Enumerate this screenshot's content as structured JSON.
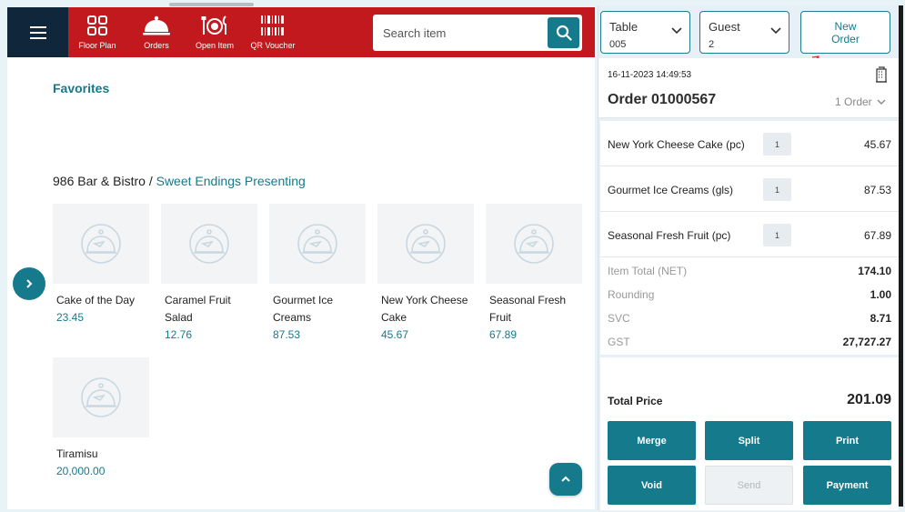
{
  "nav": {
    "items": [
      {
        "label": "Floor Plan",
        "icon": "grid-icon"
      },
      {
        "label": "Orders",
        "icon": "cloche-icon"
      },
      {
        "label": "Open Item",
        "icon": "cutlery-plate-icon"
      },
      {
        "label": "QR Voucher",
        "icon": "barcode-icon"
      }
    ],
    "search_placeholder": "Search item"
  },
  "favorites": {
    "title": "Favorites"
  },
  "breadcrumb": {
    "venue": "986 Bar & Bistro",
    "separator": " / ",
    "category": "Sweet Endings Presenting"
  },
  "products": [
    {
      "name": "Cake of the Day",
      "price": "23.45"
    },
    {
      "name": "Caramel Fruit Salad",
      "price": "12.76"
    },
    {
      "name": "Gourmet Ice Creams",
      "price": "87.53"
    },
    {
      "name": "New York Cheese Cake",
      "price": "45.67"
    },
    {
      "name": "Seasonal Fresh Fruit",
      "price": "67.89"
    },
    {
      "name": "Tiramisu",
      "price": "20,000.00"
    }
  ],
  "order_panel": {
    "table": {
      "label": "Table",
      "value": "005"
    },
    "guest": {
      "label": "Guest",
      "value": "2"
    },
    "new_order_label": "New Order",
    "datetime": "16-11-2023 14:49:53",
    "order_number": "Order 01000567",
    "order_count": "1 Order",
    "items": [
      {
        "name": "New York Cheese Cake (pc)",
        "qty": "1",
        "price": "45.67"
      },
      {
        "name": "Gourmet Ice Creams (gls)",
        "qty": "1",
        "price": "87.53"
      },
      {
        "name": "Seasonal Fresh Fruit (pc)",
        "qty": "1",
        "price": "67.89"
      }
    ],
    "summary": [
      {
        "label": "Item Total (NET)",
        "value": "174.10"
      },
      {
        "label": "Rounding",
        "value": "1.00"
      },
      {
        "label": "SVC",
        "value": "8.71"
      },
      {
        "label": "GST",
        "value": "27,727.27"
      }
    ],
    "total_label": "Total Price",
    "total_value": "201.09",
    "actions": {
      "merge": "Merge",
      "split": "Split",
      "print": "Print",
      "void": "Void",
      "send": "Send",
      "payment": "Payment"
    }
  },
  "colors": {
    "header_red": "#c2191f",
    "navy": "#10263a",
    "teal": "#157a8c",
    "panel_bg": "#e6f0f6"
  }
}
